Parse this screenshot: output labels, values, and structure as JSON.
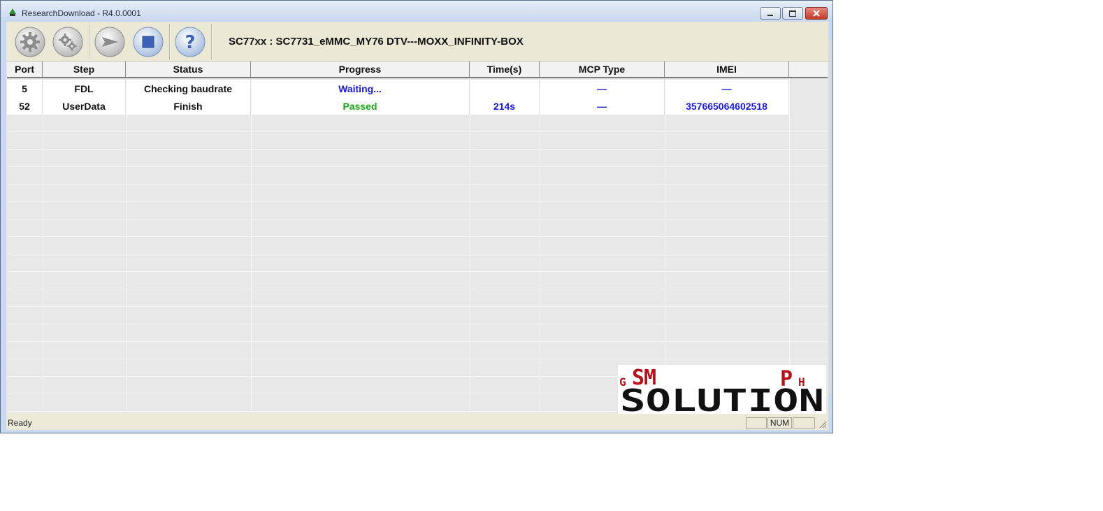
{
  "window": {
    "title": "ResearchDownload - R4.0.0001"
  },
  "toolbar": {
    "buttons": [
      {
        "name": "load-packet-button",
        "icon": "gear-icon"
      },
      {
        "name": "settings-button",
        "icon": "gears-icon"
      },
      {
        "name": "start-download-button",
        "icon": "play-arrow-icon"
      },
      {
        "name": "stop-download-button",
        "icon": "stop-icon"
      },
      {
        "name": "help-button",
        "icon": "question-icon"
      }
    ],
    "device_label": "SC77xx : SC7731_eMMC_MY76 DTV---MOXX_INFINITY-BOX"
  },
  "table": {
    "columns": [
      "Port",
      "Step",
      "Status",
      "Progress",
      "Time(s)",
      "MCP Type",
      "IMEI"
    ],
    "rows": [
      {
        "port": "5",
        "step": "FDL",
        "status": "Checking baudrate",
        "progress": "Waiting...",
        "time": "",
        "mcp_type": "—",
        "imei": "—"
      },
      {
        "port": "52",
        "step": "UserData",
        "status": "Finish",
        "progress": "Passed",
        "time": "214s",
        "mcp_type": "—",
        "imei": "357665064602518"
      }
    ]
  },
  "statusbar": {
    "text": "Ready",
    "num_indicator": "NUM"
  },
  "watermark": {
    "line1_left": "GSM",
    "line1_right": "PH",
    "line2": "SOLUTION"
  },
  "colors": {
    "progress_waiting": "#1a1adb",
    "progress_passed": "#19a519",
    "value_blue": "#1a1adb",
    "watermark_red": "#b3121b",
    "watermark_black": "#111111"
  }
}
